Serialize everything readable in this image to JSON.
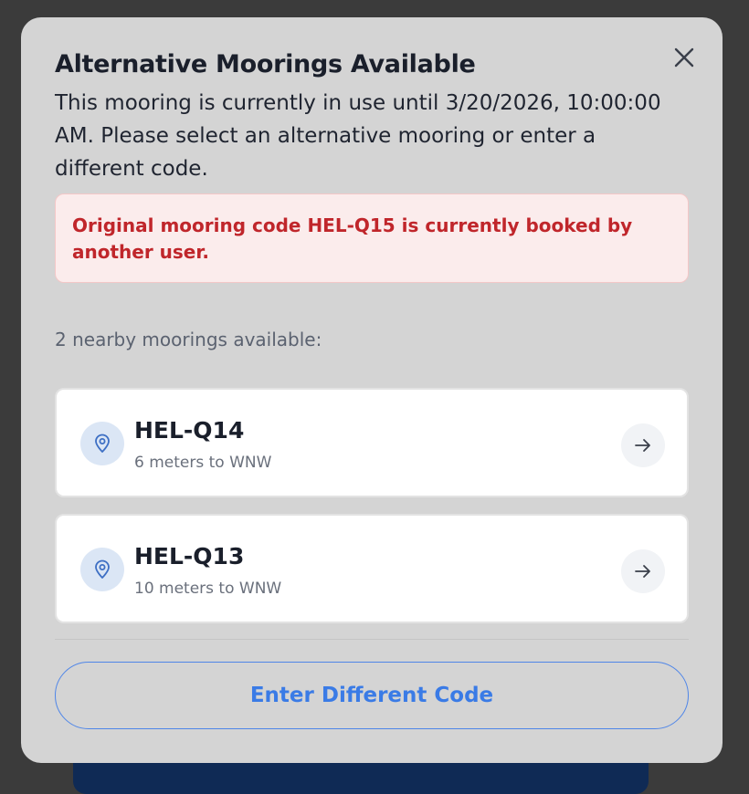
{
  "modal": {
    "title": "Alternative Moorings Available",
    "subtitle": "This mooring is currently in use until 3/20/2026, 10:00:00 AM. Please select an alternative mooring or enter a different code.",
    "alert": "Original mooring code HEL-Q15 is currently booked by another user.",
    "count_text": "2 nearby moorings available:",
    "moorings": [
      {
        "code": "HEL-Q14",
        "distance": "6 meters to WNW"
      },
      {
        "code": "HEL-Q13",
        "distance": "10 meters to WNW"
      }
    ],
    "enter_button_label": "Enter Different Code"
  },
  "icons": {
    "close": "close-icon",
    "location": "map-pin-icon",
    "arrow": "arrow-right-icon"
  },
  "colors": {
    "accent": "#3a7be6",
    "alert_text": "#c0262b",
    "alert_bg": "#fbecec"
  }
}
